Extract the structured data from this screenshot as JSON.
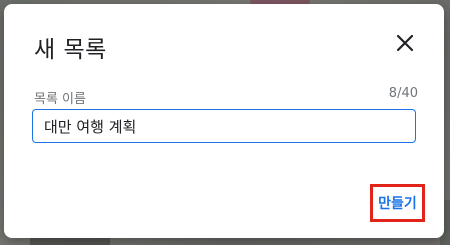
{
  "dialog": {
    "title": "새 목록",
    "close_icon": "close-icon",
    "name_field": {
      "label": "목록 이름",
      "value": "대만 여행 계획",
      "char_count": "8/40"
    },
    "create_label": "만들기"
  },
  "colors": {
    "accent": "#1a73e8",
    "highlight_box": "#e2231a",
    "title_text": "#202124",
    "secondary_text": "#70757a"
  }
}
